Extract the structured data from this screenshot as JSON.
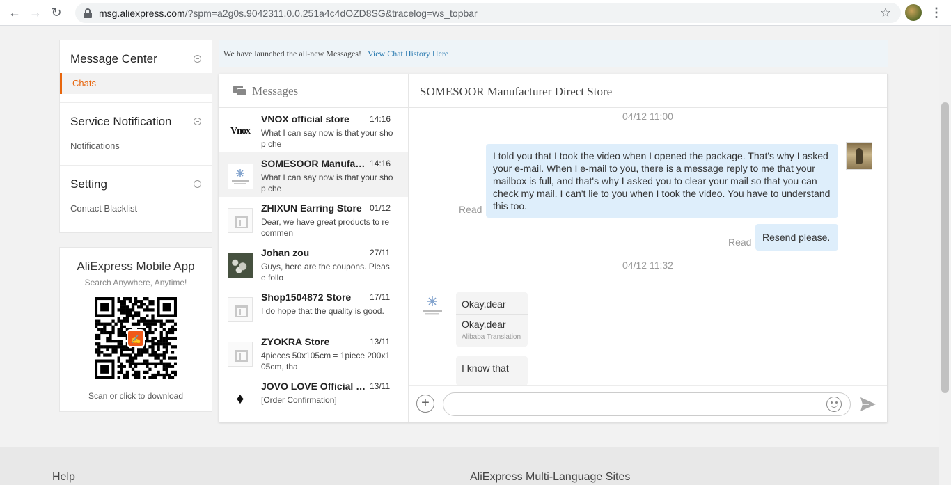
{
  "browser": {
    "url_host": "msg.aliexpress.com",
    "url_path": "/?spm=a2g0s.9042311.0.0.251a4c4dOZD8SG&tracelog=ws_topbar"
  },
  "sidebar": {
    "sections": [
      {
        "title": "Message Center",
        "items": [
          "Chats"
        ]
      },
      {
        "title": "Service Notification",
        "items": [
          "Notifications"
        ]
      },
      {
        "title": "Setting",
        "items": [
          "Contact Blacklist"
        ]
      }
    ]
  },
  "app_promo": {
    "title": "AliExpress Mobile App",
    "subtitle": "Search Anywhere, Anytime!",
    "footer": "Scan or click to download"
  },
  "banner": {
    "text": "We have launched the all-new Messages!",
    "link": "View Chat History Here"
  },
  "conversation_list": {
    "title": "Messages",
    "items": [
      {
        "name": "VNOX official store",
        "time": "14:16",
        "preview": "What I can say now is that your shop che",
        "avatar": "vnox-logo"
      },
      {
        "name": "SOMESOOR Manufacturer Direct Store",
        "time": "14:16",
        "preview": "What I can say now is that your shop che",
        "avatar": "somesoor-logo"
      },
      {
        "name": "ZHIXUN Earring Store",
        "time": "01/12",
        "preview": "Dear, we have great products to recommen",
        "avatar": "store-icon"
      },
      {
        "name": "Johan zou",
        "time": "27/11",
        "preview": "Guys, here are the coupons. Please follo",
        "avatar": "user-photo"
      },
      {
        "name": "Shop1504872 Store",
        "time": "17/11",
        "preview": "I do hope that the quality is good.",
        "avatar": "store-icon"
      },
      {
        "name": "ZYOKRA Store",
        "time": "13/11",
        "preview": "4pieces 50x105cm = 1piece 200x105cm, tha",
        "avatar": "store-icon"
      },
      {
        "name": "JOVO LOVE Official Store",
        "time": "13/11",
        "preview": "[Order Confirmation]",
        "avatar": "jovo-logo"
      }
    ]
  },
  "conversation": {
    "title": "SOMESOOR Manufacturer Direct Store",
    "timestamp1": "04/12 11:00",
    "read_label": "Read",
    "out_message_1": "I told you that I took the video when I opened the package. That's why I asked your e-mail. When I e-mail to you, there is a message reply to me that your mailbox is full, and that's why I asked you to clear your mail so that you can check my mail. I can't lie to you when I took the video. You have to understand this too.",
    "out_message_2": "Resend please.",
    "timestamp2": "04/12 11:32",
    "in_message_1_original": "Okay,dear",
    "in_message_1_translated": "Okay,dear",
    "translation_label": "Alibaba Translation",
    "in_message_2": "I know that"
  },
  "composer": {
    "placeholder": ""
  },
  "footer": {
    "help": "Help",
    "languages": "AliExpress Multi-Language Sites"
  },
  "colors": {
    "accent_orange": "#e8660d",
    "bubble_out": "#deeefb",
    "link_blue": "#2a7ab0"
  }
}
